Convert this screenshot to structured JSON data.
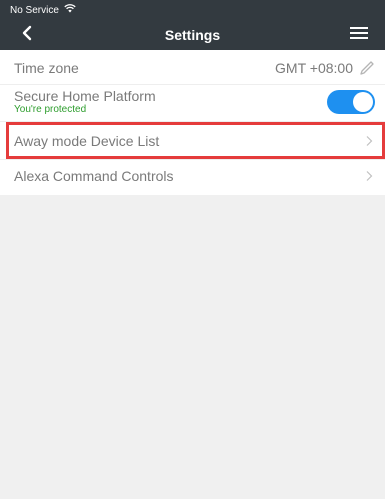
{
  "status_bar": {
    "carrier": "No Service",
    "wifi_icon": "wifi-icon"
  },
  "header": {
    "title": "Settings",
    "back_icon": "chevron-left-icon",
    "menu_icon": "hamburger-menu-icon"
  },
  "settings": {
    "time_zone": {
      "label": "Time zone",
      "value": "GMT +08:00"
    },
    "secure_home": {
      "label": "Secure Home Platform",
      "status": "You're protected",
      "enabled": true
    },
    "away_mode": {
      "label": "Away mode Device List"
    },
    "alexa": {
      "label": "Alexa Command Controls"
    }
  },
  "colors": {
    "nav_bg": "#333a40",
    "toggle_on": "#1e90f0",
    "highlight": "#e53c3c",
    "status_green": "#2d9d2d"
  }
}
